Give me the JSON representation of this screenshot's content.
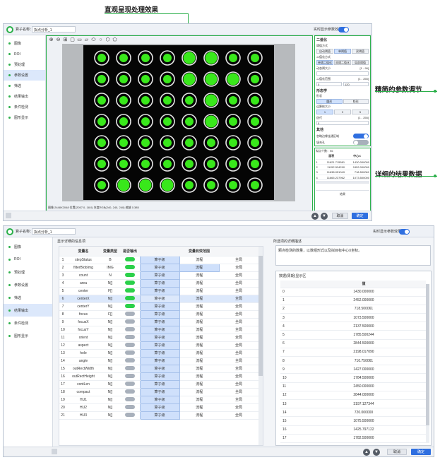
{
  "annotations": {
    "top": "直观呈现处理效果",
    "right_params": "精简的参数调节",
    "right_results": "详细的结果数据"
  },
  "colors": {
    "accent_green": "#2bb04a",
    "toggle_blue": "#2f6fe0",
    "highlight": "#dce8fb"
  },
  "window1": {
    "name_label": "算子名称：",
    "name_value": "拟点分析_1",
    "realtime_label": "实时显示参数效果",
    "sidebar": [
      "图像",
      "ROI",
      "预处理",
      "参数设置",
      "筛选",
      "结果输出",
      "条件检测",
      "图形显示"
    ],
    "active_index": 3,
    "toolbar_icons": [
      "zoom-in-icon",
      "zoom-out-icon",
      "fit-icon",
      "select-icon",
      "rect-icon",
      "rect2-icon",
      "ellipse-icon",
      "circle-icon",
      "polygon-icon",
      "polygon2-icon"
    ],
    "status_text": "图像:2448X2048 位置(2057.0, 18.0) 灰度RGB(240, 240, 240) 缩放 0.385",
    "params": {
      "group1": "二值化",
      "sub1": "阈值方式",
      "mode_buttons": [
        "自动阈值",
        "单阈值",
        "双阈值"
      ],
      "sub2": "二值化方式",
      "method_buttons": [
        "单阈二值化",
        "双阈二值化",
        "局部阈值"
      ],
      "min_area_label": "动态阈大小",
      "min_area_range": "[1 - 99]",
      "thresh_label": "二值化范围",
      "thresh_range": "[1 - 255]",
      "thresh_low": "0",
      "thresh_high": "120",
      "group2": "形态学",
      "shape_label": "形状",
      "shape_buttons": [
        "圆形",
        "矩形"
      ],
      "size_label": "运算核大小",
      "size_buttons": [
        "1",
        "3",
        "5"
      ],
      "iter_label": "迭代",
      "iter_range": "[1 - 255]",
      "iter_value": "0",
      "group3": "其他",
      "fill_label": "忽略边缘连通区域",
      "fill2_label": "填充孔"
    },
    "results": {
      "count_label": "拟点个数：",
      "count_value": "96",
      "headers": [
        "",
        "面积",
        "中心X"
      ],
      "rows": [
        [
          "1",
          "11621.715581",
          "1430.000000"
        ],
        [
          "2",
          "11152.534290",
          "2452.000000"
        ],
        [
          "3",
          "11638.051049",
          "718.500061"
        ],
        [
          "4",
          "11665.237962",
          "1073.500000"
        ]
      ],
      "result_tab": "结果"
    },
    "buttons": {
      "cancel": "取消",
      "ok": "确定"
    }
  },
  "window2": {
    "name_label": "算子名称：",
    "name_value": "拟点分析_1",
    "realtime_label": "实时显示参数效果",
    "sidebar": [
      "图像",
      "ROI",
      "预处理",
      "参数设置",
      "筛选",
      "结果输出",
      "条件检测",
      "图形显示"
    ],
    "active_index": 5,
    "list_title": "显示详细的信息项",
    "headers": [
      "",
      "变量名",
      "变量类型",
      "是否输出",
      "变量有效范围",
      "",
      ""
    ],
    "rows": [
      [
        "1",
        "stepStatus",
        "B",
        "on",
        "算子级",
        "流程",
        "全局"
      ],
      [
        "2",
        "filterBlobImg",
        "IMG",
        "on",
        "算子级",
        "流程",
        "全局"
      ],
      [
        "3",
        "count",
        "N",
        "on",
        "算子级",
        "流程",
        "全局"
      ],
      [
        "4",
        "area",
        "N[]",
        "on",
        "算子级",
        "流程",
        "全局"
      ],
      [
        "5",
        "center",
        "F[]",
        "on",
        "算子级",
        "流程",
        "全局"
      ],
      [
        "6",
        "centerX",
        "N[]",
        "on",
        "算子级",
        "流程",
        "全局"
      ],
      [
        "7",
        "centerY",
        "N[]",
        "on",
        "算子级",
        "流程",
        "全局"
      ],
      [
        "8",
        "focus",
        "F[]",
        "off",
        "算子级",
        "流程",
        "全局"
      ],
      [
        "9",
        "focusX",
        "N[]",
        "off",
        "算子级",
        "流程",
        "全局"
      ],
      [
        "10",
        "focusY",
        "N[]",
        "off",
        "算子级",
        "流程",
        "全局"
      ],
      [
        "11",
        "orient",
        "N[]",
        "off",
        "算子级",
        "流程",
        "全局"
      ],
      [
        "12",
        "aspect",
        "N[]",
        "off",
        "算子级",
        "流程",
        "全局"
      ],
      [
        "13",
        "hole",
        "N[]",
        "off",
        "算子级",
        "流程",
        "全局"
      ],
      [
        "14",
        "angle",
        "N[]",
        "off",
        "算子级",
        "流程",
        "全局"
      ],
      [
        "15",
        "outRectWidth",
        "N[]",
        "off",
        "算子级",
        "流程",
        "全局"
      ],
      [
        "16",
        "outRectHeight",
        "N[]",
        "off",
        "算子级",
        "流程",
        "全局"
      ],
      [
        "17",
        "contLen",
        "N[]",
        "off",
        "算子级",
        "流程",
        "全局"
      ],
      [
        "18",
        "compact",
        "N[]",
        "off",
        "算子级",
        "流程",
        "全局"
      ],
      [
        "19",
        "HU1",
        "N[]",
        "off",
        "算子级",
        "流程",
        "全局"
      ],
      [
        "20",
        "HU2",
        "N[]",
        "off",
        "算子级",
        "流程",
        "全局"
      ],
      [
        "21",
        "HU3",
        "N[]",
        "off",
        "算子级",
        "流程",
        "全局"
      ]
    ],
    "selected_row": 5,
    "desc_title": "所选项的详细描述",
    "desc_text": "颗点检测的数量，以数组形式以及拟目标中心X坐标。",
    "data_title": "数据(周期)显示区",
    "value_header": "值",
    "values": [
      [
        "0",
        "1430.000000"
      ],
      [
        "1",
        "2452.000000"
      ],
      [
        "2",
        "718.500061"
      ],
      [
        "3",
        "1073.500000"
      ],
      [
        "4",
        "2137.500000"
      ],
      [
        "5",
        "1785.500244"
      ],
      [
        "6",
        "2844.500000"
      ],
      [
        "7",
        "2198.017090"
      ],
      [
        "8",
        "710.750061"
      ],
      [
        "9",
        "1427.000000"
      ],
      [
        "10",
        "1784.500000"
      ],
      [
        "11",
        "2450.000000"
      ],
      [
        "12",
        "2844.000000"
      ],
      [
        "13",
        "3197.127344"
      ],
      [
        "14",
        "720.000000"
      ],
      [
        "15",
        "1075.500000"
      ],
      [
        "16",
        "1425.797122"
      ],
      [
        "17",
        "1782.500000"
      ]
    ],
    "buttons": {
      "cancel": "取消",
      "ok": "确定"
    }
  }
}
